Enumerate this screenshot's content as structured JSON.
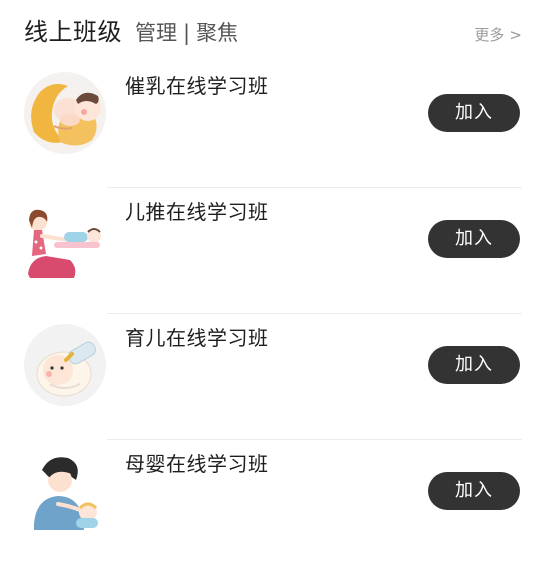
{
  "header": {
    "title": "线上班级",
    "manage_label": "管理",
    "separator": "|",
    "focus_label": "聚焦",
    "more_label": "更多",
    "more_chevron": ">"
  },
  "classes": [
    {
      "name": "催乳在线学习班",
      "button_label": "加入",
      "icon": "breastfeeding-mother-illustration"
    },
    {
      "name": "儿推在线学习班",
      "button_label": "加入",
      "icon": "pediatric-massage-illustration"
    },
    {
      "name": "育儿在线学习班",
      "button_label": "加入",
      "icon": "baby-bottle-illustration"
    },
    {
      "name": "母婴在线学习班",
      "button_label": "加入",
      "icon": "mother-baby-care-illustration"
    }
  ],
  "colors": {
    "button_bg": "#333333",
    "button_text": "#ffffff",
    "more_text": "#9a9a9a",
    "divider": "#ececec"
  }
}
